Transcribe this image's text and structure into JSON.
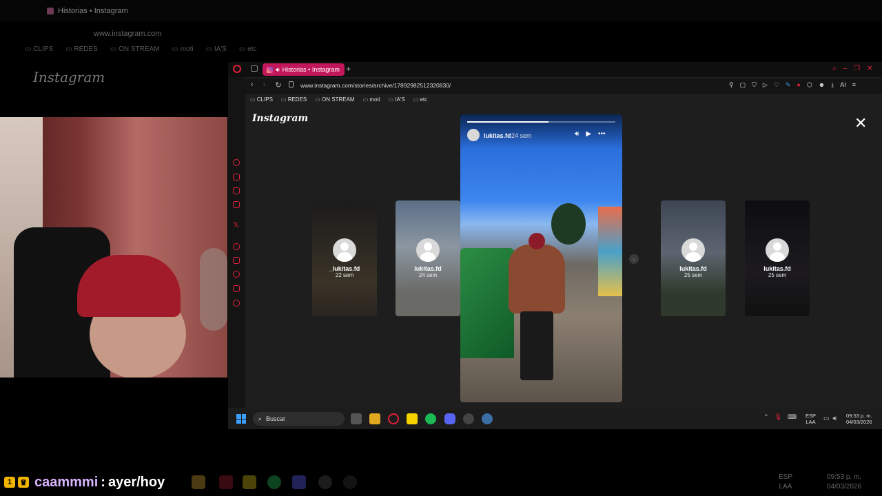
{
  "background_window": {
    "tab_title": "Historias • Instagram",
    "url": "www.instagram.com",
    "bookmarks": [
      "CLIPS",
      "REDES",
      "ON STREAM",
      "moti",
      "IA'S",
      "etc"
    ],
    "logo": "Instagram",
    "lang": [
      "ESP",
      "LAA"
    ],
    "clock": [
      "09:53 p. m.",
      "04/03/2026"
    ]
  },
  "chat": {
    "badge": "1",
    "user": "caammmi",
    "separator": ":",
    "message": "ayer/hoy"
  },
  "browser": {
    "tab_title": "Historias • Instagram",
    "new_tab": "+",
    "url": "www.instagram.com/stories/archive/17892982512320830/",
    "bookmarks": [
      "CLIPS",
      "REDES",
      "ON STREAM",
      "moti",
      "IA'S",
      "etc"
    ],
    "toolbar_ai_label": "AI",
    "accent": "#e0203a",
    "tab_color": "#c2185b"
  },
  "instagram": {
    "logo": "Instagram",
    "close": "✕",
    "story": {
      "user": "lukitas.fd",
      "time": "24 sem",
      "progress": 0.55
    },
    "cards": [
      {
        "name": "_lukitas.fd",
        "time": "22 sem"
      },
      {
        "name": "lukitas.fd",
        "time": "24 sem"
      },
      {
        "name": "lukitas.fd",
        "time": "25 sem"
      },
      {
        "name": "lukitas.fd",
        "time": "25 sem"
      }
    ]
  },
  "taskbar": {
    "search_placeholder": "Buscar",
    "lang": [
      "ESP",
      "LAA"
    ],
    "clock": [
      "09:53 p. m.",
      "04/03/2026"
    ]
  }
}
